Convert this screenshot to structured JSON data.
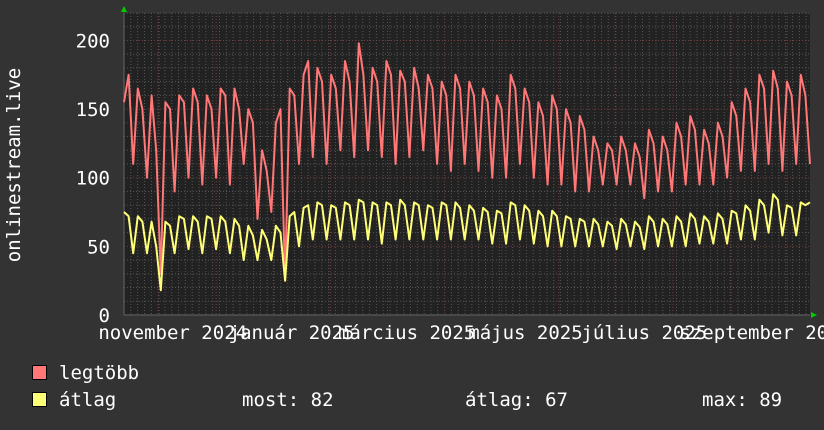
{
  "chart_data": {
    "type": "line",
    "title": "",
    "ylabel": "onlinestream.live",
    "xlabel": "",
    "ylim": [
      0,
      220
    ],
    "y_ticks": [
      "0",
      "50",
      "100",
      "150",
      "200"
    ],
    "y_tick_values": [
      0,
      50,
      100,
      150,
      200
    ],
    "x_range_days": 352,
    "x_start": "2024-10-07",
    "x_ticks": [
      {
        "label": "november 2024",
        "day": 25
      },
      {
        "label": "január 2025",
        "day": 86
      },
      {
        "label": "március 2025",
        "day": 145
      },
      {
        "label": "május 2025",
        "day": 206
      },
      {
        "label": "július 2025",
        "day": 267
      },
      {
        "label": "szeptember 2025",
        "day": 329
      }
    ],
    "grid": true,
    "series": [
      {
        "name": "legtöbb",
        "color": "#ff7777",
        "values": [
          155,
          175,
          110,
          165,
          150,
          100,
          160,
          120,
          30,
          155,
          150,
          90,
          160,
          155,
          100,
          165,
          155,
          95,
          160,
          150,
          100,
          165,
          160,
          95,
          165,
          150,
          110,
          150,
          140,
          70,
          120,
          105,
          75,
          140,
          150,
          25,
          165,
          160,
          110,
          175,
          185,
          115,
          180,
          170,
          110,
          175,
          165,
          120,
          185,
          170,
          115,
          198,
          175,
          120,
          180,
          170,
          115,
          185,
          175,
          110,
          178,
          170,
          115,
          180,
          165,
          120,
          175,
          165,
          110,
          170,
          160,
          105,
          175,
          165,
          110,
          170,
          160,
          105,
          165,
          155,
          100,
          160,
          150,
          100,
          175,
          165,
          110,
          165,
          155,
          100,
          155,
          145,
          95,
          160,
          150,
          95,
          150,
          140,
          90,
          145,
          135,
          90,
          130,
          120,
          95,
          125,
          120,
          95,
          130,
          120,
          95,
          125,
          115,
          85,
          135,
          125,
          90,
          130,
          120,
          90,
          140,
          130,
          95,
          145,
          135,
          95,
          135,
          125,
          95,
          140,
          130,
          100,
          155,
          145,
          105,
          165,
          155,
          105,
          175,
          165,
          110,
          178,
          165,
          105,
          170,
          160,
          110,
          175,
          160,
          110
        ]
      },
      {
        "name": "átlag",
        "color": "#ffff77",
        "values": [
          75,
          72,
          45,
          72,
          68,
          45,
          68,
          50,
          18,
          68,
          65,
          45,
          72,
          70,
          48,
          72,
          68,
          45,
          72,
          70,
          48,
          72,
          68,
          45,
          70,
          65,
          40,
          65,
          58,
          40,
          62,
          55,
          40,
          65,
          60,
          25,
          72,
          75,
          50,
          78,
          80,
          55,
          82,
          80,
          55,
          80,
          78,
          55,
          82,
          80,
          55,
          84,
          82,
          55,
          82,
          80,
          52,
          82,
          80,
          55,
          84,
          80,
          55,
          82,
          80,
          55,
          80,
          78,
          55,
          82,
          80,
          55,
          82,
          78,
          55,
          80,
          76,
          55,
          78,
          75,
          52,
          76,
          74,
          52,
          82,
          80,
          55,
          80,
          76,
          52,
          76,
          72,
          50,
          76,
          72,
          50,
          72,
          70,
          50,
          70,
          68,
          50,
          70,
          66,
          50,
          68,
          65,
          48,
          70,
          66,
          50,
          68,
          64,
          48,
          72,
          68,
          50,
          70,
          66,
          50,
          72,
          68,
          50,
          74,
          70,
          52,
          72,
          68,
          52,
          74,
          70,
          52,
          76,
          74,
          55,
          80,
          76,
          55,
          84,
          80,
          60,
          88,
          84,
          58,
          80,
          78,
          58,
          82,
          80,
          82
        ]
      }
    ]
  },
  "legend": {
    "max_label": "legtöbb",
    "avg_label": "átlag",
    "now": "most: 82",
    "average": "átlag: 67",
    "maximum": "max: 89"
  }
}
